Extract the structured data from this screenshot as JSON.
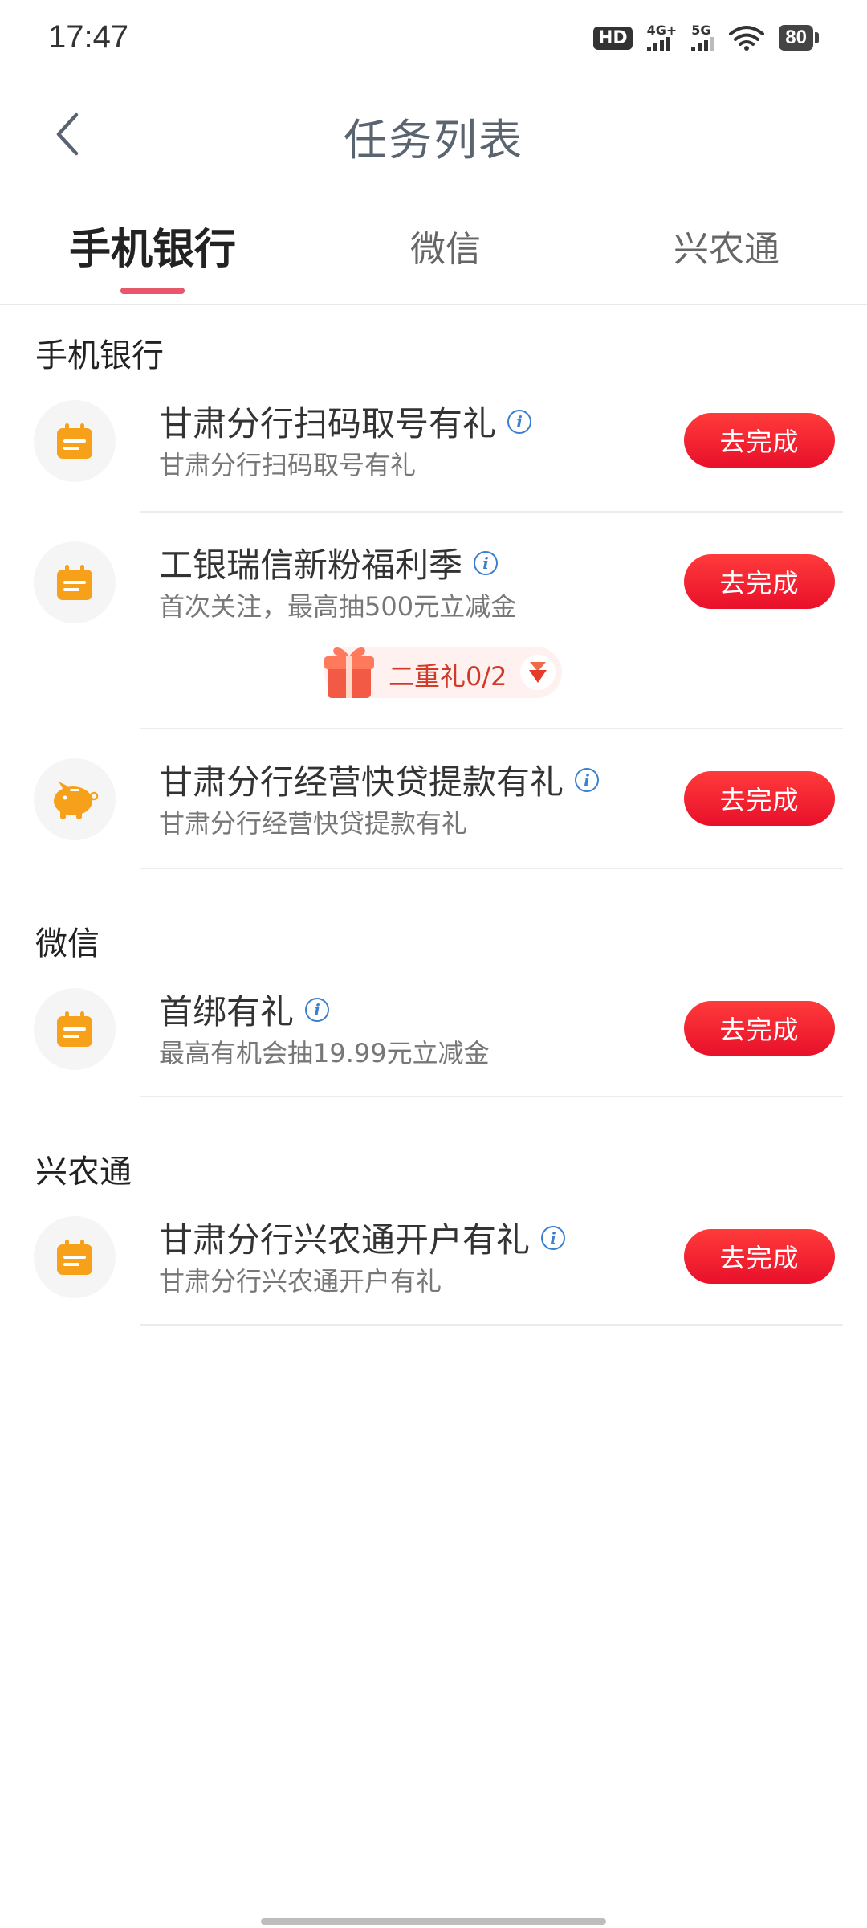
{
  "status_bar": {
    "time": "17:47",
    "hd_label": "HD",
    "net1_label": "4G+",
    "net2_label": "5G",
    "battery_level": "80"
  },
  "header": {
    "title": "任务列表",
    "back_icon": "chevron-left-icon"
  },
  "tabs": [
    {
      "label": "手机银行",
      "active": true
    },
    {
      "label": "微信",
      "active": false
    },
    {
      "label": "兴农通",
      "active": false
    }
  ],
  "sections": {
    "mobile_bank": {
      "title": "手机银行",
      "tasks": [
        {
          "title": "甘肃分行扫码取号有礼",
          "desc": "甘肃分行扫码取号有礼",
          "button": "去完成",
          "icon": "calendar-icon"
        },
        {
          "title": "工银瑞信新粉福利季",
          "desc": "首次关注，最高抽500元立减金",
          "button": "去完成",
          "icon": "calendar-icon",
          "reward": {
            "label": "二重礼0/2",
            "icon": "gift-icon",
            "toggle_icon": "expand-arrow-icon"
          }
        },
        {
          "title": "甘肃分行经营快贷提款有礼",
          "desc": "甘肃分行经营快贷提款有礼",
          "button": "去完成",
          "icon": "piggy-bank-icon"
        }
      ]
    },
    "wechat": {
      "title": "微信",
      "tasks": [
        {
          "title": "首绑有礼",
          "desc": "最高有机会抽19.99元立减金",
          "button": "去完成",
          "icon": "calendar-icon"
        }
      ]
    },
    "xingnongtong": {
      "title": "兴农通",
      "tasks": [
        {
          "title": "甘肃分行兴农通开户有礼",
          "desc": "甘肃分行兴农通开户有礼",
          "button": "去完成",
          "icon": "calendar-icon"
        }
      ]
    }
  },
  "colors": {
    "accent_red": "#e8102a",
    "tab_indicator": "#e8566a",
    "icon_orange": "#f7a11a",
    "info_blue": "#3a7fd0"
  }
}
